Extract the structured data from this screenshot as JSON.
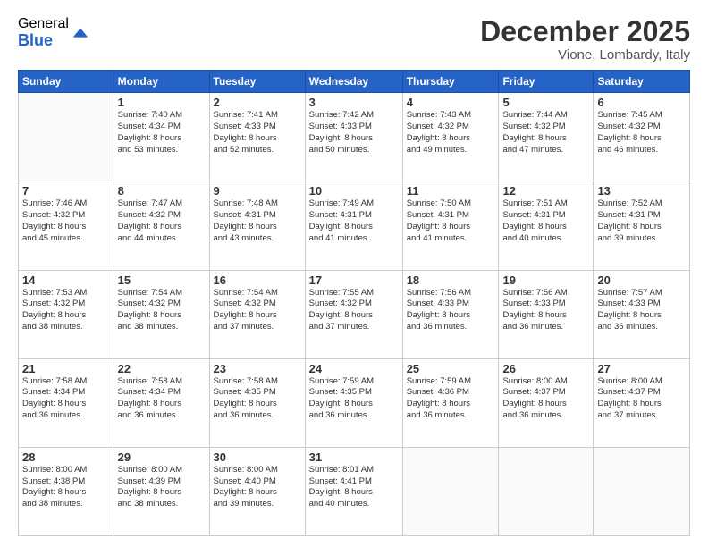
{
  "logo": {
    "general": "General",
    "blue": "Blue"
  },
  "header": {
    "month": "December 2025",
    "location": "Vione, Lombardy, Italy"
  },
  "weekdays": [
    "Sunday",
    "Monday",
    "Tuesday",
    "Wednesday",
    "Thursday",
    "Friday",
    "Saturday"
  ],
  "days": [
    {
      "date": "",
      "info": ""
    },
    {
      "date": "1",
      "info": "Sunrise: 7:40 AM\nSunset: 4:34 PM\nDaylight: 8 hours\nand 53 minutes."
    },
    {
      "date": "2",
      "info": "Sunrise: 7:41 AM\nSunset: 4:33 PM\nDaylight: 8 hours\nand 52 minutes."
    },
    {
      "date": "3",
      "info": "Sunrise: 7:42 AM\nSunset: 4:33 PM\nDaylight: 8 hours\nand 50 minutes."
    },
    {
      "date": "4",
      "info": "Sunrise: 7:43 AM\nSunset: 4:32 PM\nDaylight: 8 hours\nand 49 minutes."
    },
    {
      "date": "5",
      "info": "Sunrise: 7:44 AM\nSunset: 4:32 PM\nDaylight: 8 hours\nand 47 minutes."
    },
    {
      "date": "6",
      "info": "Sunrise: 7:45 AM\nSunset: 4:32 PM\nDaylight: 8 hours\nand 46 minutes."
    },
    {
      "date": "7",
      "info": "Sunrise: 7:46 AM\nSunset: 4:32 PM\nDaylight: 8 hours\nand 45 minutes."
    },
    {
      "date": "8",
      "info": "Sunrise: 7:47 AM\nSunset: 4:32 PM\nDaylight: 8 hours\nand 44 minutes."
    },
    {
      "date": "9",
      "info": "Sunrise: 7:48 AM\nSunset: 4:31 PM\nDaylight: 8 hours\nand 43 minutes."
    },
    {
      "date": "10",
      "info": "Sunrise: 7:49 AM\nSunset: 4:31 PM\nDaylight: 8 hours\nand 41 minutes."
    },
    {
      "date": "11",
      "info": "Sunrise: 7:50 AM\nSunset: 4:31 PM\nDaylight: 8 hours\nand 41 minutes."
    },
    {
      "date": "12",
      "info": "Sunrise: 7:51 AM\nSunset: 4:31 PM\nDaylight: 8 hours\nand 40 minutes."
    },
    {
      "date": "13",
      "info": "Sunrise: 7:52 AM\nSunset: 4:31 PM\nDaylight: 8 hours\nand 39 minutes."
    },
    {
      "date": "14",
      "info": "Sunrise: 7:53 AM\nSunset: 4:32 PM\nDaylight: 8 hours\nand 38 minutes."
    },
    {
      "date": "15",
      "info": "Sunrise: 7:54 AM\nSunset: 4:32 PM\nDaylight: 8 hours\nand 38 minutes."
    },
    {
      "date": "16",
      "info": "Sunrise: 7:54 AM\nSunset: 4:32 PM\nDaylight: 8 hours\nand 37 minutes."
    },
    {
      "date": "17",
      "info": "Sunrise: 7:55 AM\nSunset: 4:32 PM\nDaylight: 8 hours\nand 37 minutes."
    },
    {
      "date": "18",
      "info": "Sunrise: 7:56 AM\nSunset: 4:33 PM\nDaylight: 8 hours\nand 36 minutes."
    },
    {
      "date": "19",
      "info": "Sunrise: 7:56 AM\nSunset: 4:33 PM\nDaylight: 8 hours\nand 36 minutes."
    },
    {
      "date": "20",
      "info": "Sunrise: 7:57 AM\nSunset: 4:33 PM\nDaylight: 8 hours\nand 36 minutes."
    },
    {
      "date": "21",
      "info": "Sunrise: 7:58 AM\nSunset: 4:34 PM\nDaylight: 8 hours\nand 36 minutes."
    },
    {
      "date": "22",
      "info": "Sunrise: 7:58 AM\nSunset: 4:34 PM\nDaylight: 8 hours\nand 36 minutes."
    },
    {
      "date": "23",
      "info": "Sunrise: 7:58 AM\nSunset: 4:35 PM\nDaylight: 8 hours\nand 36 minutes."
    },
    {
      "date": "24",
      "info": "Sunrise: 7:59 AM\nSunset: 4:35 PM\nDaylight: 8 hours\nand 36 minutes."
    },
    {
      "date": "25",
      "info": "Sunrise: 7:59 AM\nSunset: 4:36 PM\nDaylight: 8 hours\nand 36 minutes."
    },
    {
      "date": "26",
      "info": "Sunrise: 8:00 AM\nSunset: 4:37 PM\nDaylight: 8 hours\nand 36 minutes."
    },
    {
      "date": "27",
      "info": "Sunrise: 8:00 AM\nSunset: 4:37 PM\nDaylight: 8 hours\nand 37 minutes."
    },
    {
      "date": "28",
      "info": "Sunrise: 8:00 AM\nSunset: 4:38 PM\nDaylight: 8 hours\nand 38 minutes."
    },
    {
      "date": "29",
      "info": "Sunrise: 8:00 AM\nSunset: 4:39 PM\nDaylight: 8 hours\nand 38 minutes."
    },
    {
      "date": "30",
      "info": "Sunrise: 8:00 AM\nSunset: 4:40 PM\nDaylight: 8 hours\nand 39 minutes."
    },
    {
      "date": "31",
      "info": "Sunrise: 8:01 AM\nSunset: 4:41 PM\nDaylight: 8 hours\nand 40 minutes."
    },
    {
      "date": "",
      "info": ""
    },
    {
      "date": "",
      "info": ""
    },
    {
      "date": "",
      "info": ""
    },
    {
      "date": "",
      "info": ""
    }
  ]
}
